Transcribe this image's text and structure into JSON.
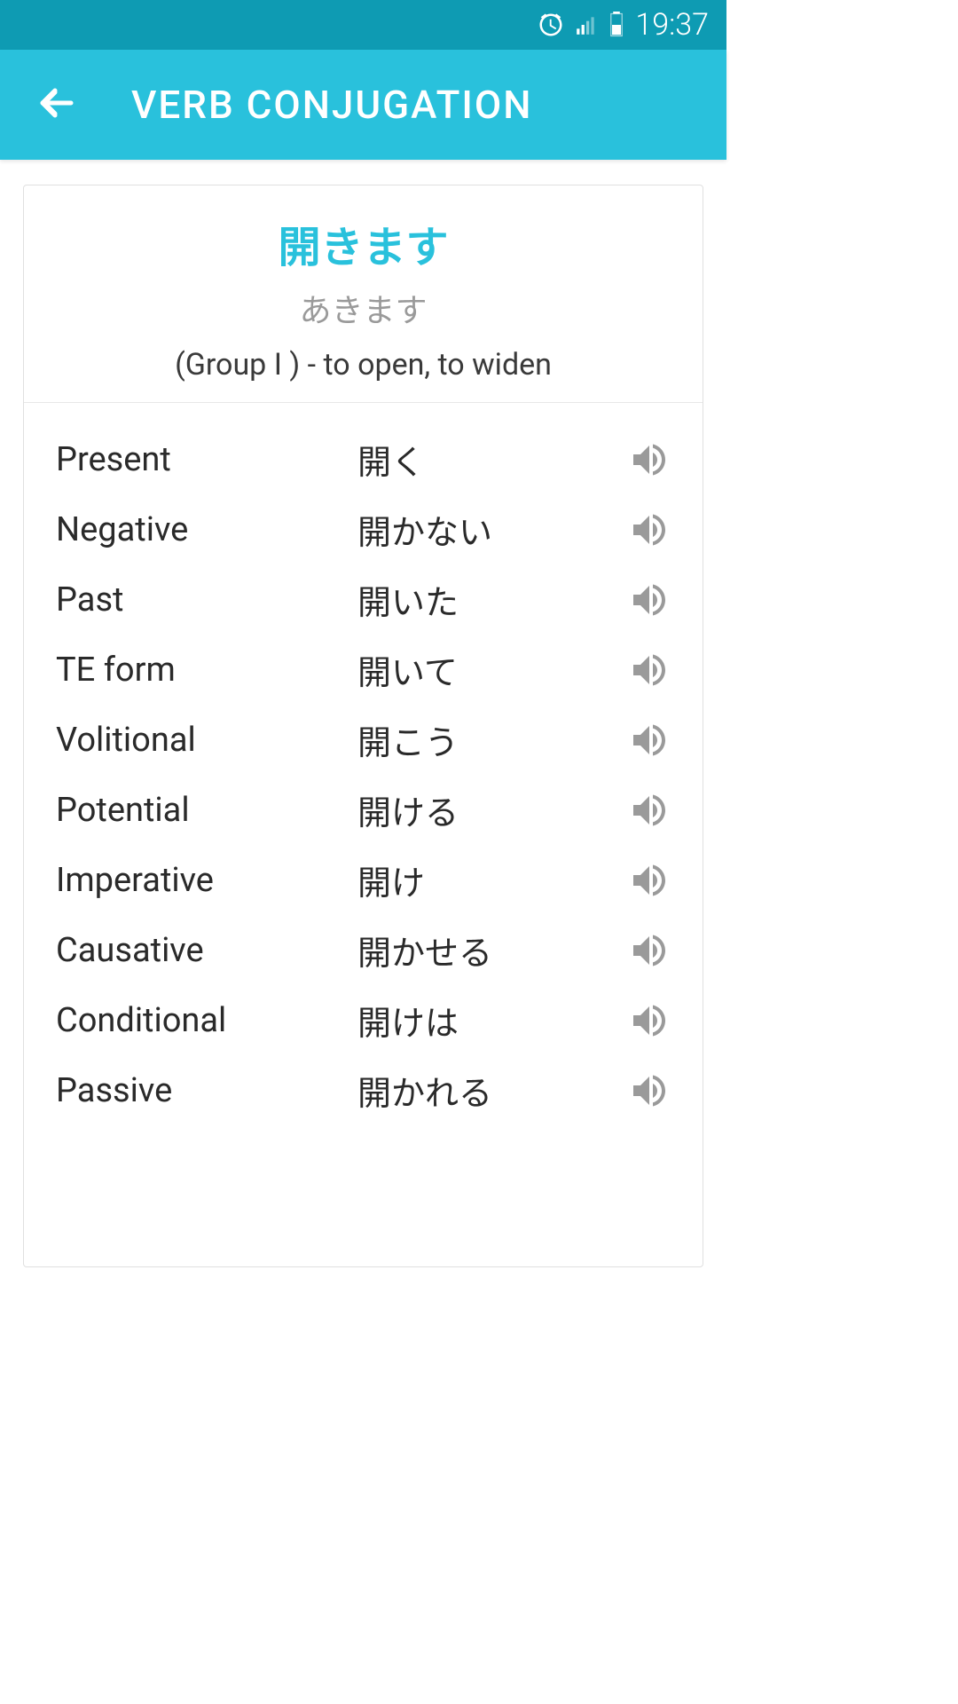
{
  "status": {
    "time": "19:37"
  },
  "header": {
    "title": "VERB CONJUGATION"
  },
  "verb": {
    "main": "開きます",
    "reading": "あきます",
    "description": "(Group I ) - to open, to widen"
  },
  "conjugations": [
    {
      "label": "Present",
      "value": "開く"
    },
    {
      "label": "Negative",
      "value": "開かない"
    },
    {
      "label": "Past",
      "value": "開いた"
    },
    {
      "label": "TE form",
      "value": "開いて"
    },
    {
      "label": "Volitional",
      "value": "開こう"
    },
    {
      "label": "Potential",
      "value": "開ける"
    },
    {
      "label": "Imperative",
      "value": "開け"
    },
    {
      "label": "Causative",
      "value": "開かせる"
    },
    {
      "label": "Conditional",
      "value": "開けは"
    },
    {
      "label": "Passive",
      "value": "開かれる"
    }
  ]
}
